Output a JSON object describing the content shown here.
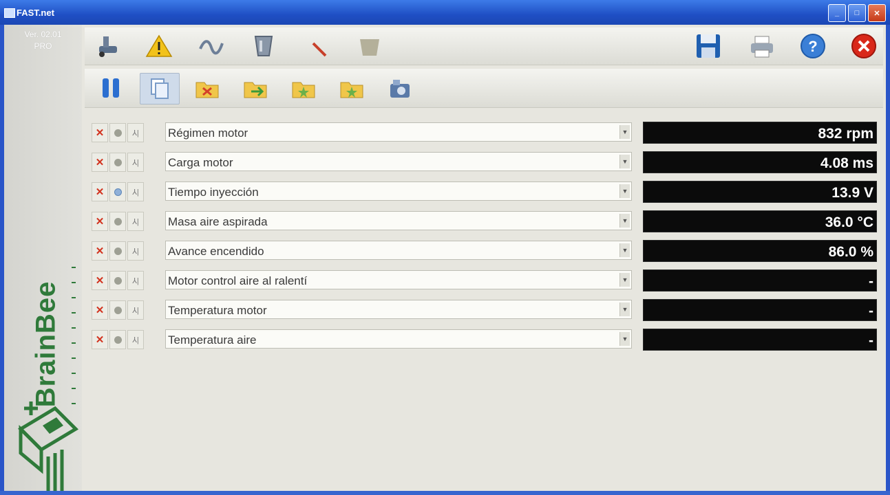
{
  "window": {
    "title": "FAST.net"
  },
  "sidebar": {
    "version_line1": "Ver. 02.01",
    "version_line2": "PRO",
    "logo_text": "BrainBee"
  },
  "toolbar_top": {
    "left_icons": [
      "car-lift-icon",
      "warning-icon",
      "wave-icon",
      "glass-icon",
      "pencil-icon",
      "bag-icon"
    ],
    "right_icons": [
      "save-icon",
      "print-icon",
      "help-icon",
      "close-icon"
    ]
  },
  "toolbar_second": {
    "icons": [
      "pause-icon",
      "copy-icon",
      "folder-open-icon",
      "folder-export-icon",
      "folder-star-icon",
      "folder-star2-icon",
      "camera-icon"
    ]
  },
  "params": [
    {
      "label": "Régimen motor",
      "value": "832 rpm"
    },
    {
      "label": "Carga motor",
      "value": "4.08 ms"
    },
    {
      "label": "Tiempo inyección",
      "value": "13.9 V"
    },
    {
      "label": "Masa aire aspirada",
      "value": "36.0 °C"
    },
    {
      "label": "Avance encendido",
      "value": "86.0 %"
    },
    {
      "label": "Motor control aire al ralentí",
      "value": "-"
    },
    {
      "label": "Temperatura motor",
      "value": "-"
    },
    {
      "label": "Temperatura aire",
      "value": "-"
    }
  ]
}
